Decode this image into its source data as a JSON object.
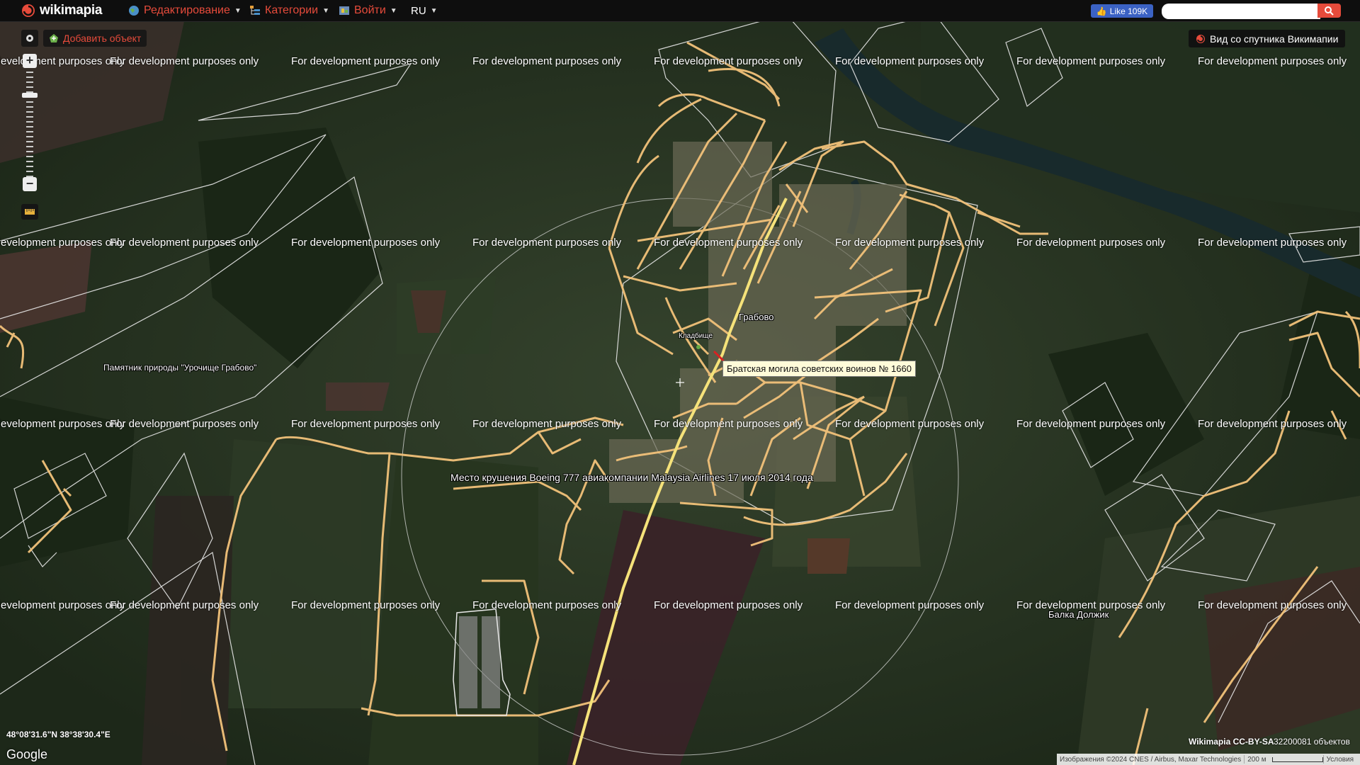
{
  "header": {
    "logo_text": "wikimapia",
    "menu": [
      {
        "label": "Редактирование",
        "icon": "globe-icon"
      },
      {
        "label": "Категории",
        "icon": "category-tree-icon"
      },
      {
        "label": "Войти",
        "icon": "login-icon"
      },
      {
        "label": "RU",
        "icon": ""
      }
    ],
    "fb_like": "Like 109K",
    "search_placeholder": ""
  },
  "toolbar": {
    "add_object": "Добавить объект",
    "satellite_view": "Вид со спутника Викимапии"
  },
  "watermark_text": "For development purposes only",
  "map_labels": {
    "village": "Грабово",
    "cemetery": "Кладбище",
    "nature_monument": "Памятник природы \"Урочище Грабово\"",
    "crash_site": "Место крушения Boeing 777 авиакомпании Malaysia Airlines 17 июля 2014 года",
    "ravine": "Балка Должик"
  },
  "tooltip": "Братская могила советских воинов № 1660",
  "coordinates": "48°08'31.6\"N 38°38'30.4\"E",
  "google_logo": "Google",
  "footer": {
    "license": "Wikimapia CC-BY-SA",
    "object_count": "32200081 объектов",
    "imagery_credit": "Изображения ©2024 CNES / Airbus, Maxar Technologies",
    "scale": "200 м",
    "terms": "Условия"
  },
  "colors": {
    "accent": "#e64b3b",
    "road": "#f2c27a",
    "main_road": "#f5e27a",
    "outline": "#e8e8e8"
  }
}
